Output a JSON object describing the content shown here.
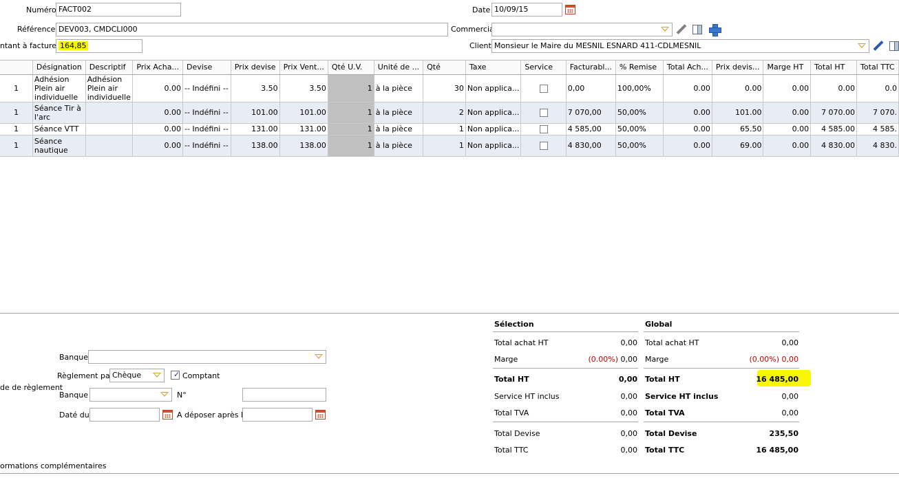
{
  "header": {
    "numero_label": "Numéro",
    "numero_value": "FACT002",
    "reference_label": "Référence",
    "reference_value": "DEV003, CMDCLI000",
    "montant_label": "ntant à facturer",
    "montant_value": "164,85",
    "date_label": "Date",
    "date_value": "10/09/15",
    "commercial_label": "Commercial",
    "commercial_value": "",
    "client_label": "Client",
    "client_value": "Monsieur le Maire du MESNIL ESNARD  411-CDLMESNIL"
  },
  "grid": {
    "columns": [
      "",
      "Désignation",
      "Descriptif",
      "Prix Acha...",
      "Devise",
      "Prix devise",
      "Prix Vent...",
      "Qté U.V.",
      "Unité de ...",
      "Qté",
      "Taxe",
      "Service",
      "Facturabl...",
      "% Remise",
      "Total Ach...",
      "Prix devis...",
      "Marge HT",
      "Total HT",
      "Total TTC"
    ],
    "rows": [
      {
        "num": "1",
        "designation": "Adhésion Plein air individuelle",
        "descriptif": "Adhésion Plein air individuelle",
        "prix_achat": "0.00",
        "devise": "-- Indéfini --",
        "prix_devise": "3.50",
        "prix_vente": "3.50",
        "qte_uv": "1",
        "unite": "à la pièce",
        "qte": "30",
        "taxe": "Non applica...",
        "facturable": "0,00",
        "remise": "100,00%",
        "total_achat": "0.00",
        "prix_devise2": "0.00",
        "marge": "0.00",
        "total_ht": "0.00",
        "total_ttc": "0.0"
      },
      {
        "num": "1",
        "designation": "Séance Tir à l'arc",
        "descriptif": "",
        "prix_achat": "0.00",
        "devise": "-- Indéfini --",
        "prix_devise": "101.00",
        "prix_vente": "101.00",
        "qte_uv": "1",
        "unite": "à la pièce",
        "qte": "2",
        "taxe": "Non applica...",
        "facturable": "7 070,00",
        "remise": "50,00%",
        "total_achat": "0.00",
        "prix_devise2": "101.00",
        "marge": "0.00",
        "total_ht": "7 070.00",
        "total_ttc": "7 070."
      },
      {
        "num": "1",
        "designation": "Séance VTT",
        "descriptif": "",
        "prix_achat": "0.00",
        "devise": "-- Indéfini --",
        "prix_devise": "131.00",
        "prix_vente": "131.00",
        "qte_uv": "1",
        "unite": "à la pièce",
        "qte": "1",
        "taxe": "Non applica...",
        "facturable": "4 585,00",
        "remise": "50,00%",
        "total_achat": "0.00",
        "prix_devise2": "65.50",
        "marge": "0.00",
        "total_ht": "4 585.00",
        "total_ttc": "4 585."
      },
      {
        "num": "1",
        "designation": "Séance nautique",
        "descriptif": "",
        "prix_achat": "0.00",
        "devise": "-- Indéfini --",
        "prix_devise": "138.00",
        "prix_vente": "138.00",
        "qte_uv": "1",
        "unite": "à la pièce",
        "qte": "1",
        "taxe": "Non applica...",
        "facturable": "4 830,00",
        "remise": "50,00%",
        "total_achat": "0.00",
        "prix_devise2": "69.00",
        "marge": "0.00",
        "total_ht": "4 830.00",
        "total_ttc": "4 830."
      }
    ]
  },
  "reglement": {
    "mode_label": "de de règlement",
    "banque_label": "Banque",
    "banque_value": "",
    "reglement_par_label": "Règlement par",
    "reglement_par_value": "Chèque",
    "comptant_label": "Comptant",
    "banque2_label": "Banque",
    "banque2_value": "",
    "numero_label": "N°",
    "numero_value": "",
    "date_du_label": "Daté du",
    "date_du_value": "",
    "deposer_label": "A déposer après le",
    "deposer_value": "",
    "infos_label": "ormations complémentaires"
  },
  "selection": {
    "title": "Sélection",
    "total_achat_label": "Total achat HT",
    "total_achat_value": "0,00",
    "marge_label": "Marge",
    "marge_pct": "(0.00%)",
    "marge_value": "0,00",
    "total_ht_label": "Total HT",
    "total_ht_value": "0,00",
    "service_label": "Service HT inclus",
    "service_value": "0,00",
    "tva_label": "Total TVA",
    "tva_value": "0,00",
    "devise_label": "Total Devise",
    "devise_value": "0,00",
    "ttc_label": "Total TTC",
    "ttc_value": "0,00"
  },
  "global": {
    "title": "Global",
    "total_achat_label": "Total achat HT",
    "total_achat_value": "0,00",
    "marge_label": "Marge",
    "marge_pct": "(0.00%)",
    "marge_value": "0,00",
    "total_ht_label": "Total HT",
    "total_ht_value": "16 485,00",
    "service_label": "Service HT inclus",
    "service_value": "0,00",
    "tva_label": "Total TVA",
    "tva_value": "0,00",
    "devise_label": "Total Devise",
    "devise_value": "235,50",
    "ttc_label": "Total TTC",
    "ttc_value": "16 485,00"
  },
  "colors": {
    "highlight": "#f7f700",
    "alt_row": "#e8ecf4",
    "readonly_cell": "#c0c0c0",
    "negative": "#c00000"
  }
}
